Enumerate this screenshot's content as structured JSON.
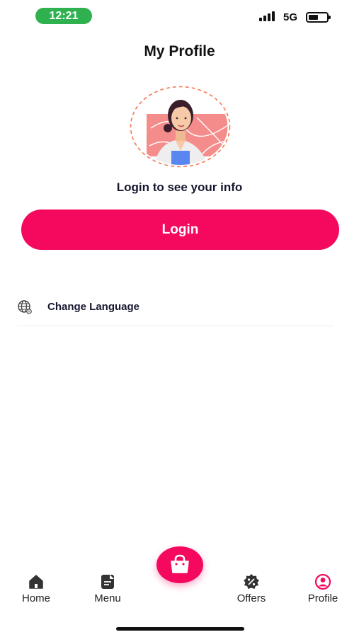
{
  "status_bar": {
    "time": "12:21",
    "network": "5G",
    "battery_level": 0.4,
    "time_color": "#2fb14f"
  },
  "page": {
    "title": "My Profile"
  },
  "profile": {
    "login_prompt": "Login to see your info",
    "login_label": "Login",
    "accent_color": "#f4095f"
  },
  "settings": {
    "items": [
      {
        "label": "Change Language",
        "icon": "globe-icon"
      }
    ]
  },
  "bottom_nav": {
    "items": [
      {
        "label": "Home",
        "icon": "home-icon",
        "active": false
      },
      {
        "label": "Menu",
        "icon": "menu-icon",
        "active": false
      },
      {
        "label": "Offers",
        "icon": "offers-icon",
        "active": false
      },
      {
        "label": "Profile",
        "icon": "profile-icon",
        "active": true
      }
    ],
    "center_action_icon": "shopping-bag-icon"
  }
}
